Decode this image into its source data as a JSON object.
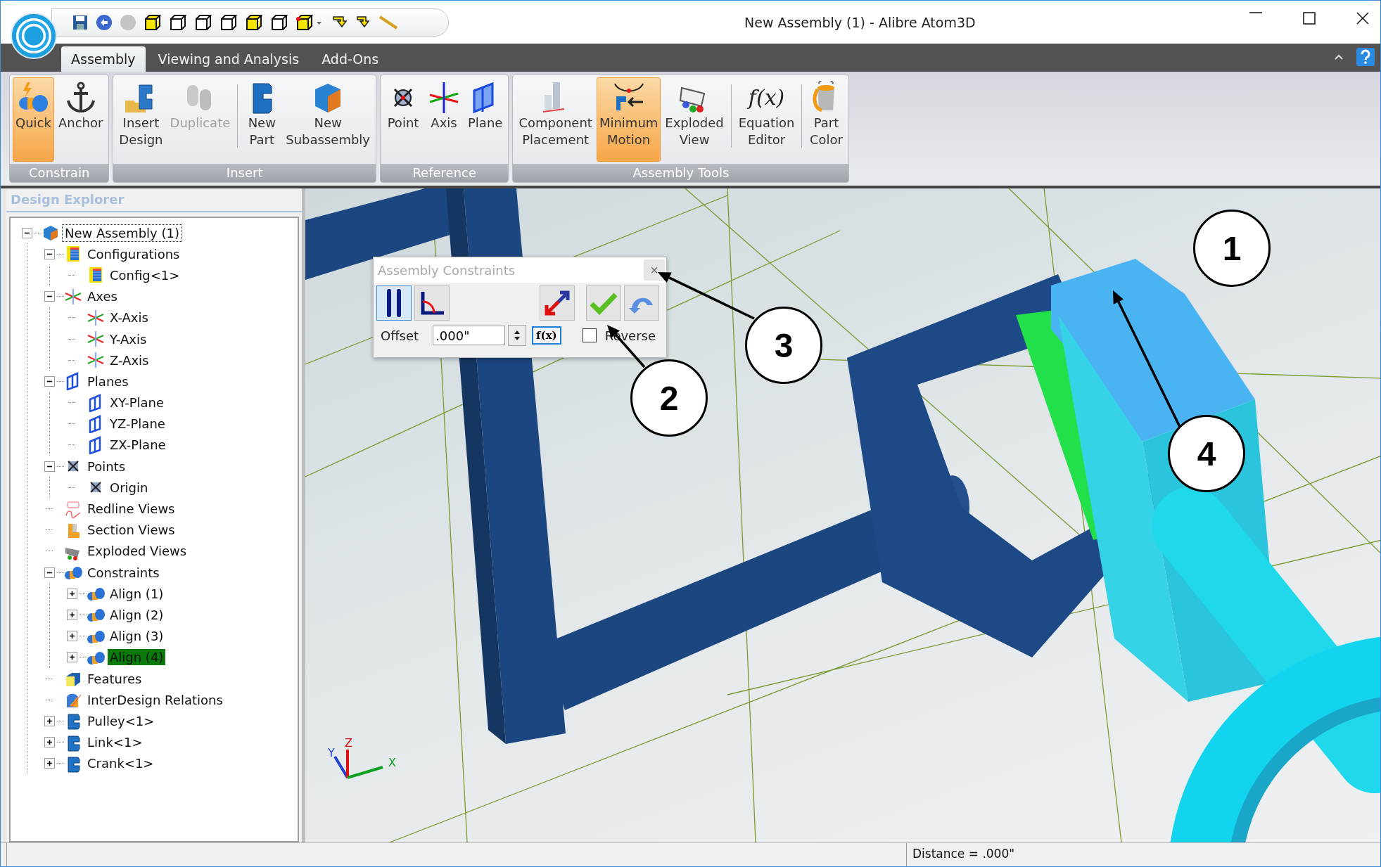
{
  "window": {
    "title": "New Assembly (1) - Alibre Atom3D"
  },
  "tabs": [
    {
      "label": "Assembly",
      "selected": true
    },
    {
      "label": "Viewing and Analysis",
      "selected": false
    },
    {
      "label": "Add-Ons",
      "selected": false
    }
  ],
  "ribbon": {
    "groups": [
      {
        "label": "Constrain",
        "buttons": [
          {
            "kind": "quick",
            "lines": [
              "Quick"
            ],
            "selected": true,
            "disabled": false
          },
          {
            "kind": "anchor",
            "lines": [
              "Anchor"
            ],
            "selected": false,
            "disabled": false
          }
        ]
      },
      {
        "label": "Insert",
        "buttons": [
          {
            "kind": "insert-design",
            "lines": [
              "Insert",
              "Design"
            ],
            "selected": false,
            "disabled": false
          },
          {
            "kind": "duplicate",
            "lines": [
              "Duplicate"
            ],
            "selected": false,
            "disabled": true
          },
          {
            "kind": "new-part",
            "lines": [
              "New",
              "Part"
            ],
            "selected": false,
            "disabled": false,
            "divider_before": true
          },
          {
            "kind": "new-subassembly",
            "lines": [
              "New",
              "Subassembly"
            ],
            "selected": false,
            "disabled": false
          }
        ]
      },
      {
        "label": "Reference",
        "buttons": [
          {
            "kind": "point",
            "lines": [
              "Point"
            ],
            "selected": false,
            "disabled": false
          },
          {
            "kind": "axis",
            "lines": [
              "Axis"
            ],
            "selected": false,
            "disabled": false
          },
          {
            "kind": "plane",
            "lines": [
              "Plane"
            ],
            "selected": false,
            "disabled": false
          }
        ]
      },
      {
        "label": "Assembly Tools",
        "buttons": [
          {
            "kind": "component-placement",
            "lines": [
              "Component",
              "Placement"
            ],
            "selected": false,
            "disabled": false
          },
          {
            "kind": "minimum-motion",
            "lines": [
              "Minimum",
              "Motion"
            ],
            "selected": true,
            "disabled": false
          },
          {
            "kind": "exploded-view",
            "lines": [
              "Exploded",
              "View"
            ],
            "selected": false,
            "disabled": false
          },
          {
            "kind": "equation-editor",
            "icon_text": "f(x)",
            "lines": [
              "Equation",
              "Editor"
            ],
            "selected": false,
            "disabled": false,
            "divider_before": true
          },
          {
            "kind": "part-color",
            "lines": [
              "Part",
              "Color"
            ],
            "selected": false,
            "disabled": false,
            "divider_before": true
          }
        ]
      }
    ]
  },
  "explorer": {
    "title": "Design Explorer",
    "tree": [
      {
        "label": "New Assembly (1)",
        "kind": "assembly",
        "expanded": true,
        "selected": false,
        "focused": true,
        "children": [
          {
            "label": "Configurations",
            "kind": "config",
            "expanded": true,
            "selected": false,
            "focused": false,
            "children": [
              {
                "label": "Config<1>",
                "kind": "config",
                "selected": false,
                "focused": false
              }
            ]
          },
          {
            "label": "Axes",
            "kind": "axis",
            "expanded": true,
            "selected": false,
            "focused": false,
            "children": [
              {
                "label": "X-Axis",
                "kind": "axis",
                "selected": false,
                "focused": false
              },
              {
                "label": "Y-Axis",
                "kind": "axis",
                "selected": false,
                "focused": false
              },
              {
                "label": "Z-Axis",
                "kind": "axis",
                "selected": false,
                "focused": false
              }
            ]
          },
          {
            "label": "Planes",
            "kind": "plane",
            "expanded": true,
            "selected": false,
            "focused": false,
            "children": [
              {
                "label": "XY-Plane",
                "kind": "plane",
                "selected": false,
                "focused": false
              },
              {
                "label": "YZ-Plane",
                "kind": "plane",
                "selected": false,
                "focused": false
              },
              {
                "label": "ZX-Plane",
                "kind": "plane",
                "selected": false,
                "focused": false
              }
            ]
          },
          {
            "label": "Points",
            "kind": "point",
            "expanded": true,
            "selected": false,
            "focused": false,
            "children": [
              {
                "label": "Origin",
                "kind": "point",
                "selected": false,
                "focused": false
              }
            ]
          },
          {
            "label": "Redline Views",
            "kind": "redline",
            "selected": false,
            "focused": false
          },
          {
            "label": "Section Views",
            "kind": "section",
            "selected": false,
            "focused": false
          },
          {
            "label": "Exploded Views",
            "kind": "exploded",
            "selected": false,
            "focused": false
          },
          {
            "label": "Constraints",
            "kind": "constraint",
            "expanded": true,
            "selected": false,
            "focused": false,
            "children": [
              {
                "label": "Align (1)",
                "kind": "constraint",
                "expanded": false,
                "selected": false,
                "focused": false
              },
              {
                "label": "Align (2)",
                "kind": "constraint",
                "expanded": false,
                "selected": false,
                "focused": false
              },
              {
                "label": "Align (3)",
                "kind": "constraint",
                "expanded": false,
                "selected": false,
                "focused": false
              },
              {
                "label": "Align (4)",
                "kind": "constraint",
                "expanded": false,
                "selected": true,
                "focused": false
              }
            ]
          },
          {
            "label": "Features",
            "kind": "features",
            "selected": false,
            "focused": false
          },
          {
            "label": "InterDesign Relations",
            "kind": "relations",
            "selected": false,
            "focused": false
          },
          {
            "label": "Pulley<1>",
            "kind": "part",
            "expanded": false,
            "selected": false,
            "focused": false
          },
          {
            "label": "Link<1>",
            "kind": "part",
            "expanded": false,
            "selected": false,
            "focused": false
          },
          {
            "label": "Crank<1>",
            "kind": "part",
            "expanded": false,
            "selected": false,
            "focused": false
          }
        ]
      }
    ]
  },
  "dialog": {
    "title": "Assembly Constraints",
    "close": "×",
    "modes": [
      {
        "kind": "parallel",
        "selected": true
      },
      {
        "kind": "angle",
        "selected": false
      }
    ],
    "offset_label": "Offset",
    "offset_value": ".000\"",
    "fx": "f(x)",
    "reverse": {
      "label": "Reverse",
      "checked": false
    }
  },
  "triad": [
    "Y",
    "Z",
    "X"
  ],
  "callouts": [
    {
      "label": "1"
    },
    {
      "label": "3"
    },
    {
      "label": "2"
    },
    {
      "label": "4"
    }
  ],
  "status_bar": {
    "message": "Distance = .000\""
  }
}
